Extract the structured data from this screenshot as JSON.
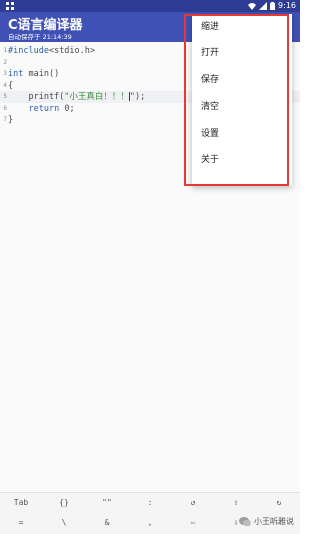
{
  "status": {
    "time": "9:16"
  },
  "app": {
    "title": "C语言编译器",
    "subtitle": "自动保存于 21:14:39"
  },
  "code": [
    {
      "num": "1",
      "parts": [
        {
          "t": "#include",
          "c": "kw"
        },
        {
          "t": "<stdio.h>",
          "c": "txt"
        }
      ]
    },
    {
      "num": "2",
      "parts": []
    },
    {
      "num": "3",
      "parts": [
        {
          "t": "int",
          "c": "kw"
        },
        {
          "t": " main()",
          "c": "txt"
        }
      ]
    },
    {
      "num": "4",
      "parts": [
        {
          "t": "{",
          "c": "txt"
        }
      ]
    },
    {
      "num": "5",
      "parts": [
        {
          "t": "    printf(",
          "c": "txt"
        },
        {
          "t": "\"小王真白！！！",
          "c": "str"
        },
        {
          "t": "|",
          "c": "cursor"
        },
        {
          "t": "\");",
          "c": "txt"
        }
      ]
    },
    {
      "num": "6",
      "parts": [
        {
          "t": "    ",
          "c": "txt"
        },
        {
          "t": "return",
          "c": "kw"
        },
        {
          "t": " 0;",
          "c": "txt"
        }
      ]
    },
    {
      "num": "7",
      "parts": [
        {
          "t": "}",
          "c": "txt"
        }
      ]
    }
  ],
  "menu": {
    "items": [
      {
        "label": "缩进"
      },
      {
        "label": "打开"
      },
      {
        "label": "保存"
      },
      {
        "label": "清空"
      },
      {
        "label": "设置"
      },
      {
        "label": "关于"
      }
    ]
  },
  "keyboard": {
    "row1": [
      "Tab",
      "{}",
      "\"\"",
      ":",
      "↺",
      "⇧",
      "↻"
    ],
    "row2": [
      "=",
      "\\",
      "&",
      ",",
      "⇦",
      "⇩",
      "⇨"
    ]
  },
  "watermark": {
    "text": "小王听雅说"
  },
  "colors": {
    "appbar": "#3f51b5",
    "statusbar": "#2f3c95",
    "highlight_outline": "#e53935"
  }
}
